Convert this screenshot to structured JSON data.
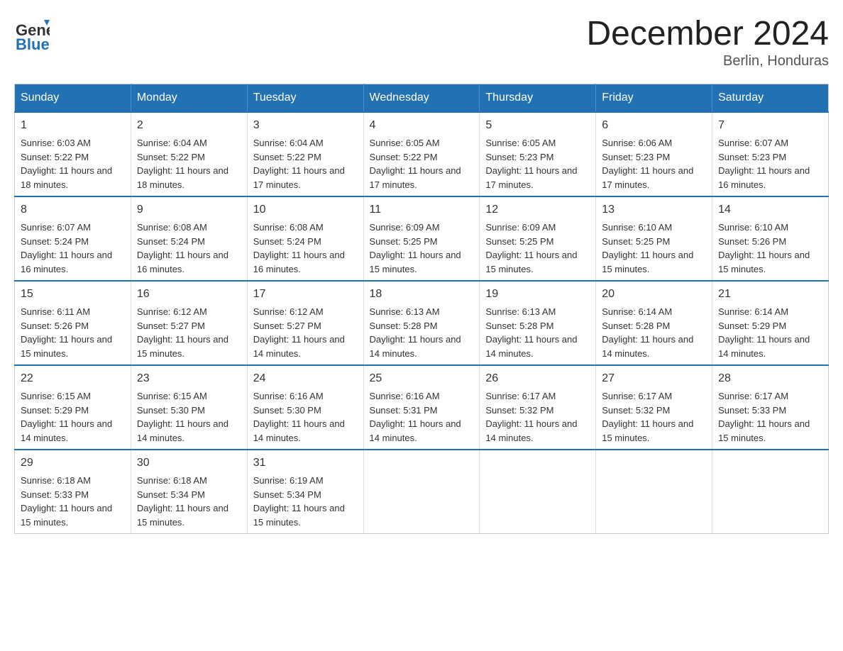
{
  "header": {
    "logo_general": "General",
    "logo_blue": "Blue",
    "month_title": "December 2024",
    "location": "Berlin, Honduras"
  },
  "days_of_week": [
    "Sunday",
    "Monday",
    "Tuesday",
    "Wednesday",
    "Thursday",
    "Friday",
    "Saturday"
  ],
  "weeks": [
    [
      {
        "day": "1",
        "sunrise": "6:03 AM",
        "sunset": "5:22 PM",
        "daylight": "11 hours and 18 minutes."
      },
      {
        "day": "2",
        "sunrise": "6:04 AM",
        "sunset": "5:22 PM",
        "daylight": "11 hours and 18 minutes."
      },
      {
        "day": "3",
        "sunrise": "6:04 AM",
        "sunset": "5:22 PM",
        "daylight": "11 hours and 17 minutes."
      },
      {
        "day": "4",
        "sunrise": "6:05 AM",
        "sunset": "5:22 PM",
        "daylight": "11 hours and 17 minutes."
      },
      {
        "day": "5",
        "sunrise": "6:05 AM",
        "sunset": "5:23 PM",
        "daylight": "11 hours and 17 minutes."
      },
      {
        "day": "6",
        "sunrise": "6:06 AM",
        "sunset": "5:23 PM",
        "daylight": "11 hours and 17 minutes."
      },
      {
        "day": "7",
        "sunrise": "6:07 AM",
        "sunset": "5:23 PM",
        "daylight": "11 hours and 16 minutes."
      }
    ],
    [
      {
        "day": "8",
        "sunrise": "6:07 AM",
        "sunset": "5:24 PM",
        "daylight": "11 hours and 16 minutes."
      },
      {
        "day": "9",
        "sunrise": "6:08 AM",
        "sunset": "5:24 PM",
        "daylight": "11 hours and 16 minutes."
      },
      {
        "day": "10",
        "sunrise": "6:08 AM",
        "sunset": "5:24 PM",
        "daylight": "11 hours and 16 minutes."
      },
      {
        "day": "11",
        "sunrise": "6:09 AM",
        "sunset": "5:25 PM",
        "daylight": "11 hours and 15 minutes."
      },
      {
        "day": "12",
        "sunrise": "6:09 AM",
        "sunset": "5:25 PM",
        "daylight": "11 hours and 15 minutes."
      },
      {
        "day": "13",
        "sunrise": "6:10 AM",
        "sunset": "5:25 PM",
        "daylight": "11 hours and 15 minutes."
      },
      {
        "day": "14",
        "sunrise": "6:10 AM",
        "sunset": "5:26 PM",
        "daylight": "11 hours and 15 minutes."
      }
    ],
    [
      {
        "day": "15",
        "sunrise": "6:11 AM",
        "sunset": "5:26 PM",
        "daylight": "11 hours and 15 minutes."
      },
      {
        "day": "16",
        "sunrise": "6:12 AM",
        "sunset": "5:27 PM",
        "daylight": "11 hours and 15 minutes."
      },
      {
        "day": "17",
        "sunrise": "6:12 AM",
        "sunset": "5:27 PM",
        "daylight": "11 hours and 14 minutes."
      },
      {
        "day": "18",
        "sunrise": "6:13 AM",
        "sunset": "5:28 PM",
        "daylight": "11 hours and 14 minutes."
      },
      {
        "day": "19",
        "sunrise": "6:13 AM",
        "sunset": "5:28 PM",
        "daylight": "11 hours and 14 minutes."
      },
      {
        "day": "20",
        "sunrise": "6:14 AM",
        "sunset": "5:28 PM",
        "daylight": "11 hours and 14 minutes."
      },
      {
        "day": "21",
        "sunrise": "6:14 AM",
        "sunset": "5:29 PM",
        "daylight": "11 hours and 14 minutes."
      }
    ],
    [
      {
        "day": "22",
        "sunrise": "6:15 AM",
        "sunset": "5:29 PM",
        "daylight": "11 hours and 14 minutes."
      },
      {
        "day": "23",
        "sunrise": "6:15 AM",
        "sunset": "5:30 PM",
        "daylight": "11 hours and 14 minutes."
      },
      {
        "day": "24",
        "sunrise": "6:16 AM",
        "sunset": "5:30 PM",
        "daylight": "11 hours and 14 minutes."
      },
      {
        "day": "25",
        "sunrise": "6:16 AM",
        "sunset": "5:31 PM",
        "daylight": "11 hours and 14 minutes."
      },
      {
        "day": "26",
        "sunrise": "6:17 AM",
        "sunset": "5:32 PM",
        "daylight": "11 hours and 14 minutes."
      },
      {
        "day": "27",
        "sunrise": "6:17 AM",
        "sunset": "5:32 PM",
        "daylight": "11 hours and 15 minutes."
      },
      {
        "day": "28",
        "sunrise": "6:17 AM",
        "sunset": "5:33 PM",
        "daylight": "11 hours and 15 minutes."
      }
    ],
    [
      {
        "day": "29",
        "sunrise": "6:18 AM",
        "sunset": "5:33 PM",
        "daylight": "11 hours and 15 minutes."
      },
      {
        "day": "30",
        "sunrise": "6:18 AM",
        "sunset": "5:34 PM",
        "daylight": "11 hours and 15 minutes."
      },
      {
        "day": "31",
        "sunrise": "6:19 AM",
        "sunset": "5:34 PM",
        "daylight": "11 hours and 15 minutes."
      },
      null,
      null,
      null,
      null
    ]
  ]
}
